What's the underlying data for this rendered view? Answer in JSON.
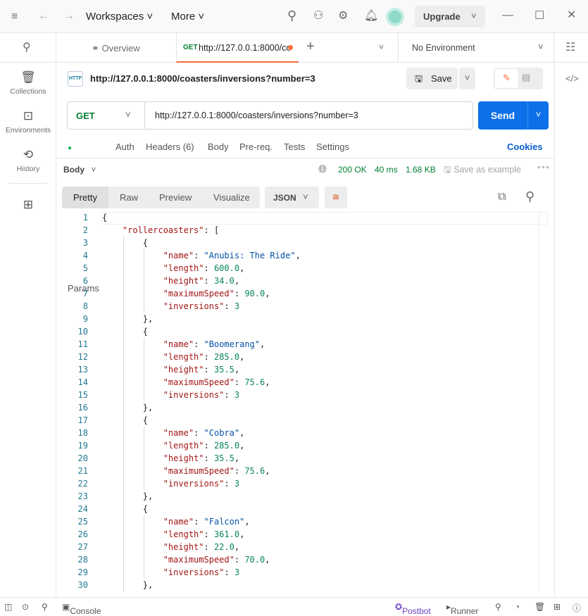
{
  "topbar": {
    "workspaces": "Workspaces",
    "more": "More",
    "upgrade": "Upgrade"
  },
  "tabs": {
    "overview": "Overview",
    "active_method": "GET",
    "active_url": "http://127.0.0.1:8000/co",
    "environment": "No Environment"
  },
  "sidebar": {
    "items": [
      {
        "label": "Collections"
      },
      {
        "label": "Environments"
      },
      {
        "label": "History"
      }
    ]
  },
  "request": {
    "title": "http://127.0.0.1:8000/coasters/inversions?number=3",
    "save": "Save",
    "method": "GET",
    "url": "http://127.0.0.1:8000/coasters/inversions?number=3",
    "send": "Send",
    "tabs": [
      "Params",
      "Auth",
      "Headers (6)",
      "Body",
      "Pre-req.",
      "Tests",
      "Settings"
    ],
    "cookies": "Cookies"
  },
  "response": {
    "body_label": "Body",
    "status": "200 OK",
    "time": "40 ms",
    "size": "1.68 KB",
    "save_example": "Save as example",
    "views": [
      "Pretty",
      "Raw",
      "Preview",
      "Visualize"
    ],
    "format": "JSON",
    "lines": [
      "{",
      "    \"rollercoasters\": [",
      "        {",
      "            \"name\": \"Anubis: The Ride\",",
      "            \"length\": 600.0,",
      "            \"height\": 34.0,",
      "            \"maximumSpeed\": 90.0,",
      "            \"inversions\": 3",
      "        },",
      "        {",
      "            \"name\": \"Boomerang\",",
      "            \"length\": 285.0,",
      "            \"height\": 35.5,",
      "            \"maximumSpeed\": 75.6,",
      "            \"inversions\": 3",
      "        },",
      "        {",
      "            \"name\": \"Cobra\",",
      "            \"length\": 285.0,",
      "            \"height\": 35.5,",
      "            \"maximumSpeed\": 75.6,",
      "            \"inversions\": 3",
      "        },",
      "        {",
      "            \"name\": \"Falcon\",",
      "            \"length\": 361.0,",
      "            \"height\": 22.0,",
      "            \"maximumSpeed\": 70.0,",
      "            \"inversions\": 3",
      "        },"
    ]
  },
  "statusbar": {
    "console": "Console",
    "postbot": "Postbot",
    "runner": "Runner"
  },
  "colors": {
    "accent": "#ff6c37",
    "send": "#0c71e8",
    "key": "#a31515",
    "string": "#0451a5",
    "number": "#098658",
    "status_ok": "#007f31"
  }
}
